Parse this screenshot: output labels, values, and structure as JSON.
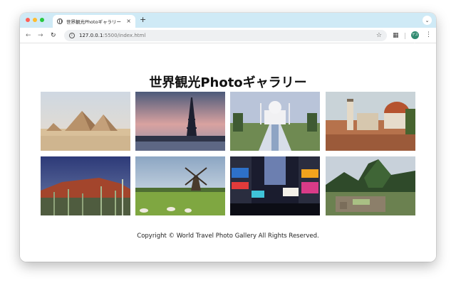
{
  "browser": {
    "tab_title": "世界観光Photoギャラリー",
    "tab_close": "×",
    "new_tab": "+",
    "tab_menu_icon": "chevron-down-icon",
    "url_host": "127.0.0.1",
    "url_path": ":5500/index.html",
    "profile_label": "ゲスト"
  },
  "page": {
    "title": "世界観光Photoギャラリー",
    "footer": "Copyright © World Travel Photo Gallery All Rights Reserved."
  },
  "gallery": [
    {
      "subject": "pyramids"
    },
    {
      "subject": "eiffel-tower"
    },
    {
      "subject": "taj-mahal"
    },
    {
      "subject": "florence-duomo"
    },
    {
      "subject": "uluru-cactus"
    },
    {
      "subject": "windmill"
    },
    {
      "subject": "times-square"
    },
    {
      "subject": "machu-picchu"
    }
  ]
}
